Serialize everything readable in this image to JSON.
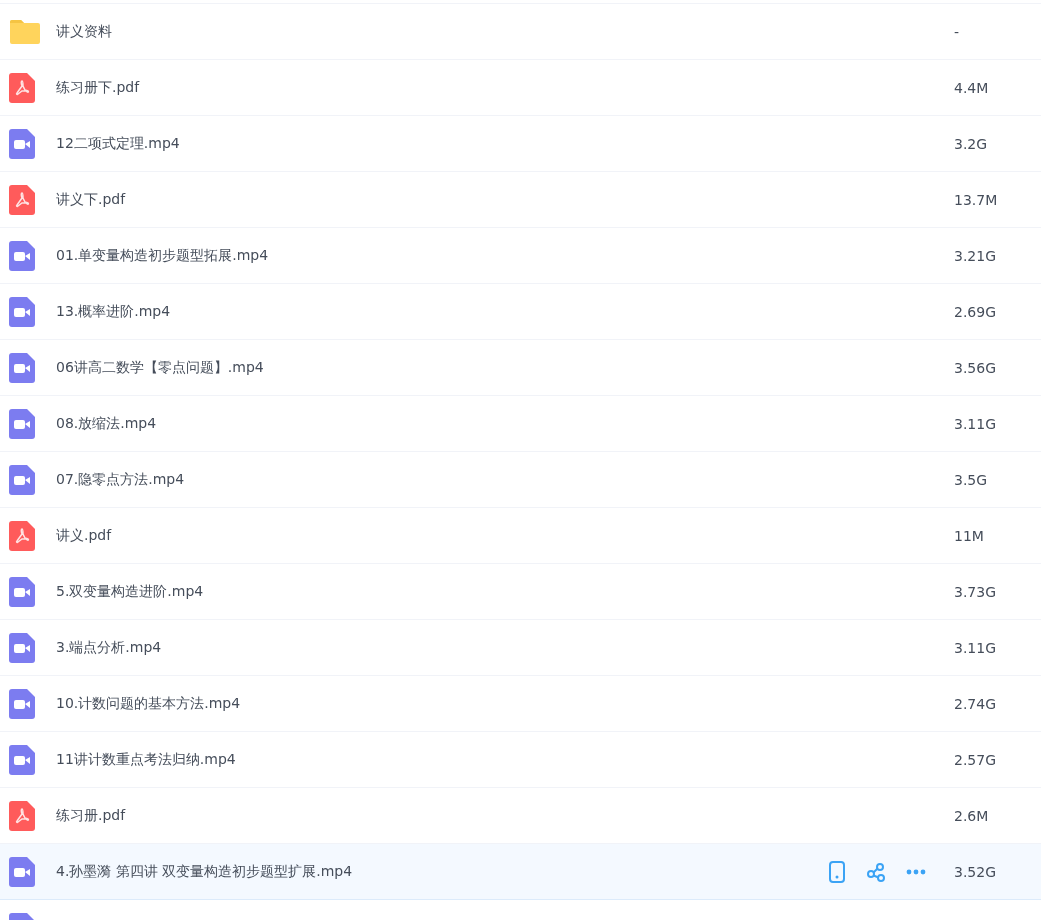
{
  "files": [
    {
      "kind": "folder",
      "name": "讲义资料",
      "size": "-",
      "hovered": false
    },
    {
      "kind": "pdf",
      "name": "练习册下.pdf",
      "size": "4.4M",
      "hovered": false
    },
    {
      "kind": "video",
      "name": "12二项式定理.mp4",
      "size": "3.2G",
      "hovered": false
    },
    {
      "kind": "pdf",
      "name": "讲义下.pdf",
      "size": "13.7M",
      "hovered": false
    },
    {
      "kind": "video",
      "name": "01.单变量构造初步题型拓展.mp4",
      "size": "3.21G",
      "hovered": false
    },
    {
      "kind": "video",
      "name": "13.概率进阶.mp4",
      "size": "2.69G",
      "hovered": false
    },
    {
      "kind": "video",
      "name": "06讲高二数学【零点问题】.mp4",
      "size": "3.56G",
      "hovered": false
    },
    {
      "kind": "video",
      "name": "08.放缩法.mp4",
      "size": "3.11G",
      "hovered": false
    },
    {
      "kind": "video",
      "name": "07.隐零点方法.mp4",
      "size": "3.5G",
      "hovered": false
    },
    {
      "kind": "pdf",
      "name": "讲义.pdf",
      "size": "11M",
      "hovered": false
    },
    {
      "kind": "video",
      "name": "5.双变量构造进阶.mp4",
      "size": "3.73G",
      "hovered": false
    },
    {
      "kind": "video",
      "name": "3.端点分析.mp4",
      "size": "3.11G",
      "hovered": false
    },
    {
      "kind": "video",
      "name": "10.计数问题的基本方法.mp4",
      "size": "2.74G",
      "hovered": false
    },
    {
      "kind": "video",
      "name": "11讲计数重点考法归纳.mp4",
      "size": "2.57G",
      "hovered": false
    },
    {
      "kind": "pdf",
      "name": "练习册.pdf",
      "size": "2.6M",
      "hovered": false
    },
    {
      "kind": "video",
      "name": "4.孙墨漪 第四讲 双变量构造初步题型扩展.mp4",
      "size": "3.52G",
      "hovered": true
    },
    {
      "kind": "video",
      "hovered": false
    }
  ]
}
